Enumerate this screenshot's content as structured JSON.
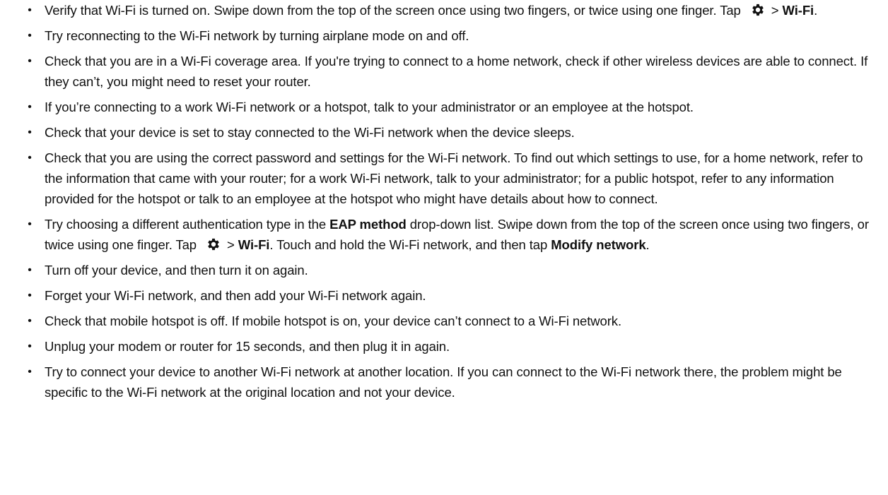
{
  "bullet_char": "•",
  "gear_icon": "settings-gear-icon",
  "items": [
    {
      "a": "Verify that Wi-Fi is turned on. Swipe down from the top of the screen once using two fingers, or twice using one finger. Tap",
      "b": "> ",
      "c": "Wi-Fi",
      "d": "."
    },
    {
      "text": "Try reconnecting to the Wi-Fi network by turning airplane mode on and off."
    },
    {
      "text": "Check that you are in a Wi-Fi coverage area. If you're trying to connect to a home network, check if other wireless devices are able to connect. If they can’t, you might need to reset your router."
    },
    {
      "text": "If you’re connecting to a work Wi-Fi network or a hotspot, talk to your administrator or an employee at the hotspot."
    },
    {
      "text": "Check that your device is set to stay connected to the Wi-Fi network when the device sleeps."
    },
    {
      "text": "Check that you are using the correct password and settings for the Wi-Fi network. To find out which settings to use, for a home network, refer to the information that came with your router; for a work Wi-Fi network, talk to your administrator; for a public hotspot, refer to any information provided for the hotspot or talk to an employee at the hotspot who might have details about how to connect."
    },
    {
      "a": "Try choosing a different authentication type in the ",
      "b": "EAP method",
      "c": " drop-down list. Swipe down from the top of the screen once using two fingers, or twice using one finger. Tap",
      "d": "> ",
      "e": "Wi-Fi",
      "f": ". Touch and hold the Wi-Fi network, and then tap ",
      "g": "Modify network",
      "h": "."
    },
    {
      "text": "Turn off your device, and then turn it on again."
    },
    {
      "text": "Forget your Wi-Fi network, and then add your Wi-Fi network again."
    },
    {
      "text": "Check that mobile hotspot is off. If mobile hotspot is on, your device can’t connect to a Wi-Fi network."
    },
    {
      "text": "Unplug your modem or router for 15 seconds, and then plug it in again."
    },
    {
      "text": "Try to connect your device to another Wi-Fi network at another location. If you can connect to the Wi-Fi network there, the problem might be specific to the Wi-Fi network at the original location and not your device."
    }
  ]
}
